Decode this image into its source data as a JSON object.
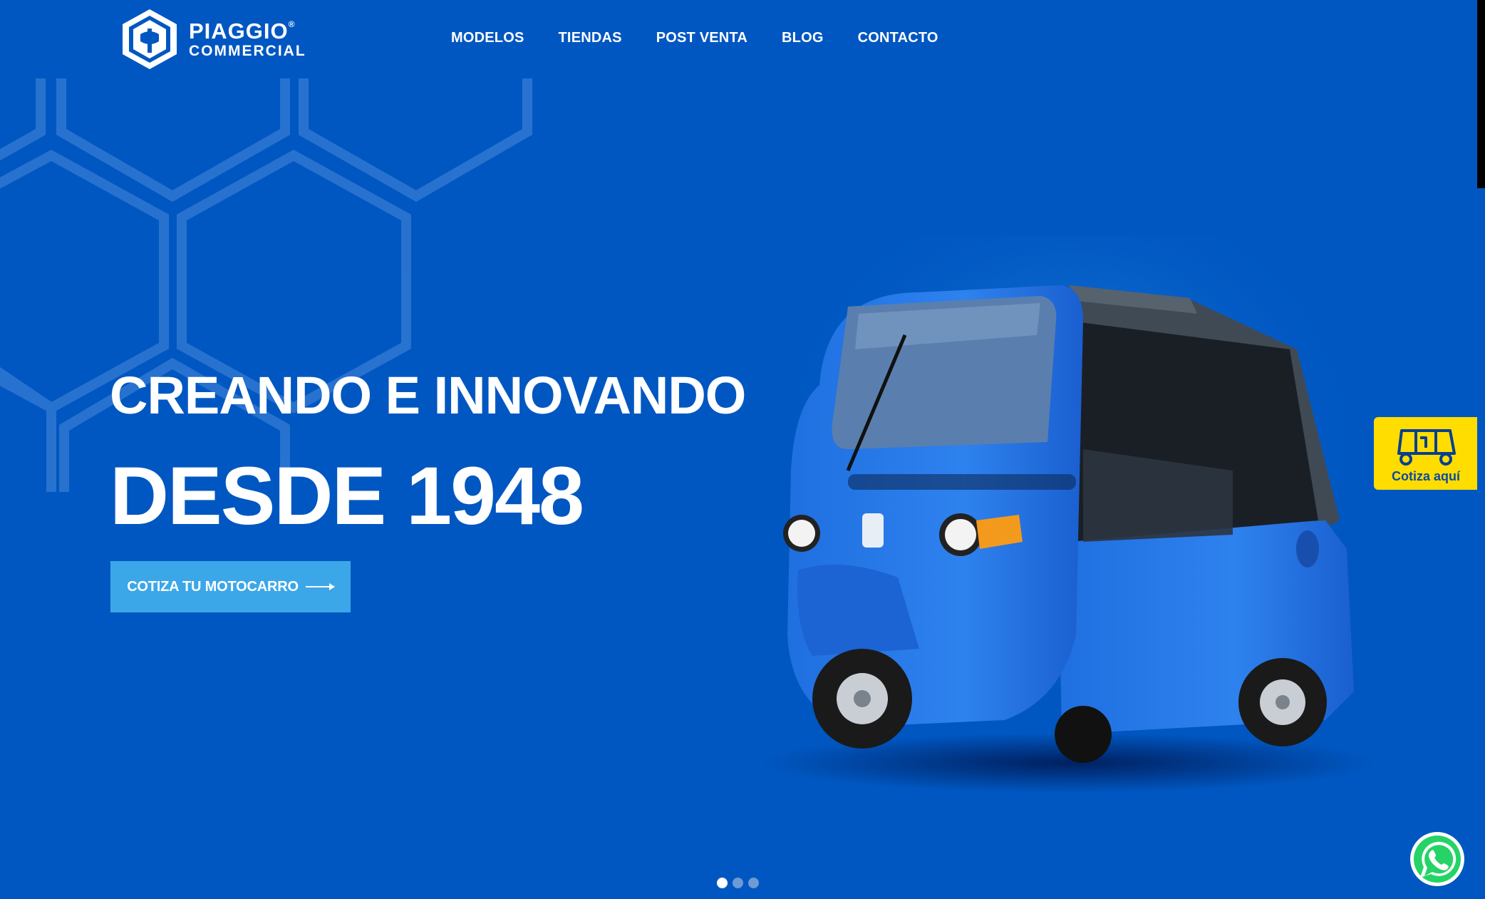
{
  "brand": {
    "name_line1": "PIAGGIO",
    "name_line2": "COMMERCIAL",
    "registered_mark": "®"
  },
  "nav": {
    "items": [
      {
        "label": "MODELOS"
      },
      {
        "label": "TIENDAS"
      },
      {
        "label": "POST VENTA"
      },
      {
        "label": "BLOG"
      },
      {
        "label": "CONTACTO"
      }
    ]
  },
  "hero": {
    "line1": "CREANDO E INNOVANDO",
    "line2": "DESDE 1948",
    "cta_label": "COTIZA TU MOTOCARRO"
  },
  "side_widget": {
    "label": "Cotiza aquí",
    "icon": "motocarro-icon"
  },
  "carousel": {
    "slide_count": 3,
    "active_index": 0
  },
  "colors": {
    "background": "#0057c1",
    "cta": "#3ca7e8",
    "side_widget": "#ffdd00",
    "whatsapp": "#25d366"
  },
  "icons": {
    "whatsapp": "whatsapp-icon",
    "arrow": "arrow-right-icon",
    "logo": "piaggio-logo-icon"
  }
}
